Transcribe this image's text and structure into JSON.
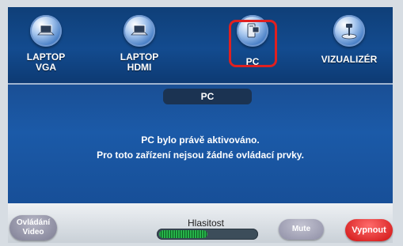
{
  "sources": [
    {
      "key": "laptop_vga",
      "label": "LAPTOP\nVGA",
      "icon": "laptop-icon"
    },
    {
      "key": "laptop_hdmi",
      "label": "LAPTOP\nHDMI",
      "icon": "laptop-icon"
    },
    {
      "key": "pc",
      "label": "PC",
      "icon": "pc-tower-icon"
    },
    {
      "key": "vizualizer",
      "label": "VIZUALIZÉR",
      "icon": "document-camera-icon"
    }
  ],
  "active_source": "pc",
  "active_title": "PC",
  "message": {
    "line1": "PC bylo právě aktivováno.",
    "line2": "Pro toto zařízení nejsou žádné ovládací prvky."
  },
  "bottom": {
    "ovladani_label": "Ovládání\nVideo",
    "volume_label": "Hlasitost",
    "volume_level": 0.5,
    "mute_label": "Mute",
    "vypnout_label": "Vypnout"
  },
  "colors": {
    "highlight": "#e02020",
    "power_button": "#cf1212",
    "volume_fill": "#27b24a",
    "panel_blue": "#1b5aa8"
  }
}
